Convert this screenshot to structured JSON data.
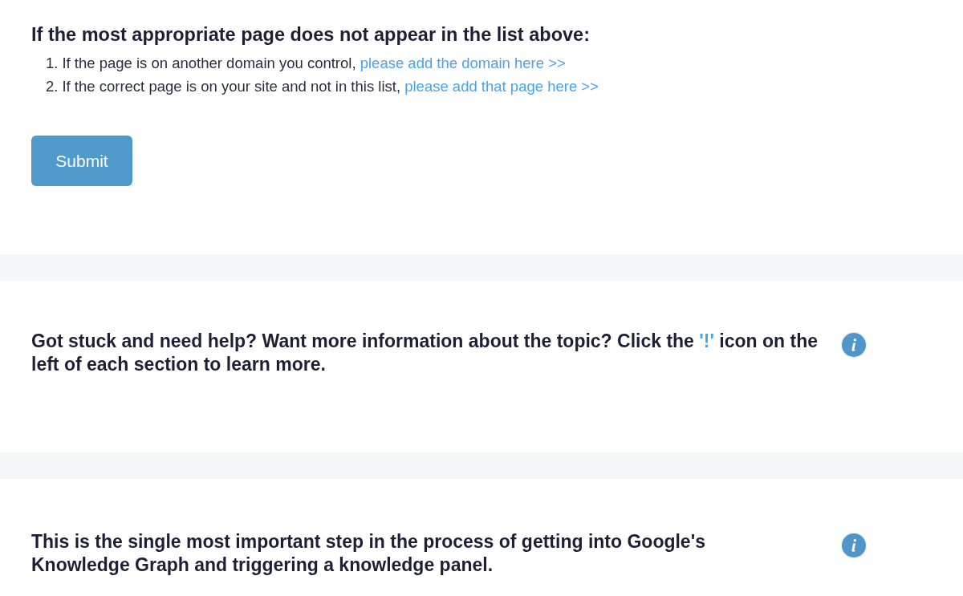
{
  "missing_page_help": {
    "heading": "If the most appropriate page does not appear in the list above:",
    "items": [
      {
        "number": "1.",
        "text": "If the page is on another domain you control,",
        "link": "please add the domain here >>"
      },
      {
        "number": "2.",
        "text": "If the correct page is on your site and not in this list,",
        "link": "please add that page here >>"
      }
    ],
    "submit_button": "Submit"
  },
  "notes": [
    {
      "parts": [
        {
          "kind": "plain",
          "text": "Got stuck and need help? Want more information about the topic? Click the"
        },
        {
          "kind": "highlight",
          "text": "'!'"
        },
        {
          "kind": "plain",
          "text": "icon on the left of each section to learn more."
        }
      ]
    },
    {
      "parts": [
        {
          "kind": "plain",
          "text": "This is the single most important step in the process of getting into Google's Knowledge Graph and triggering a knowledge panel."
        }
      ]
    }
  ]
}
